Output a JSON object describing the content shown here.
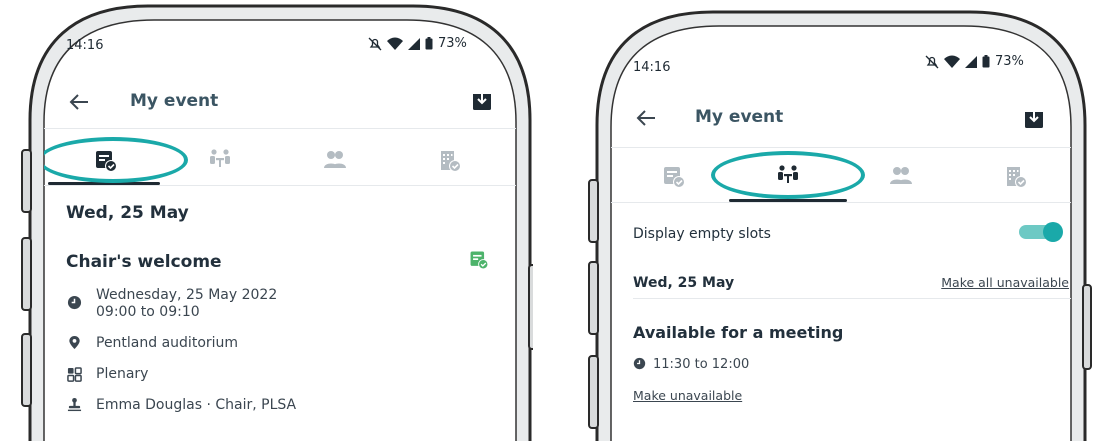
{
  "status": {
    "time": "14:16",
    "battery": "73%"
  },
  "left": {
    "header_title": "My event",
    "date_heading": "Wed, 25 May",
    "session_title": "Chair's welcome",
    "details": {
      "date_line1": "Wednesday, 25 May 2022",
      "date_line2": "09:00 to 09:10",
      "location": "Pentland auditorium",
      "type": "Plenary",
      "speaker": "Emma Douglas · Chair, PLSA"
    }
  },
  "right": {
    "header_title": "My event",
    "display_empty_label": "Display empty slots",
    "display_empty_on": true,
    "date_heading": "Wed, 25 May",
    "make_all_unavailable": "Make all unavailable",
    "slot_title": "Available for a meeting",
    "slot_time": "11:30 to 12:00",
    "make_unavailable": "Make unavailable"
  },
  "colors": {
    "accent": "#1aa9a9",
    "agenda_green": "#4db36b",
    "icon_grey": "#b4bcc2",
    "dark": "#1f2a33"
  },
  "tabs": [
    "agenda-tab",
    "meetings-tab",
    "attendees-tab",
    "exhibitors-tab"
  ]
}
